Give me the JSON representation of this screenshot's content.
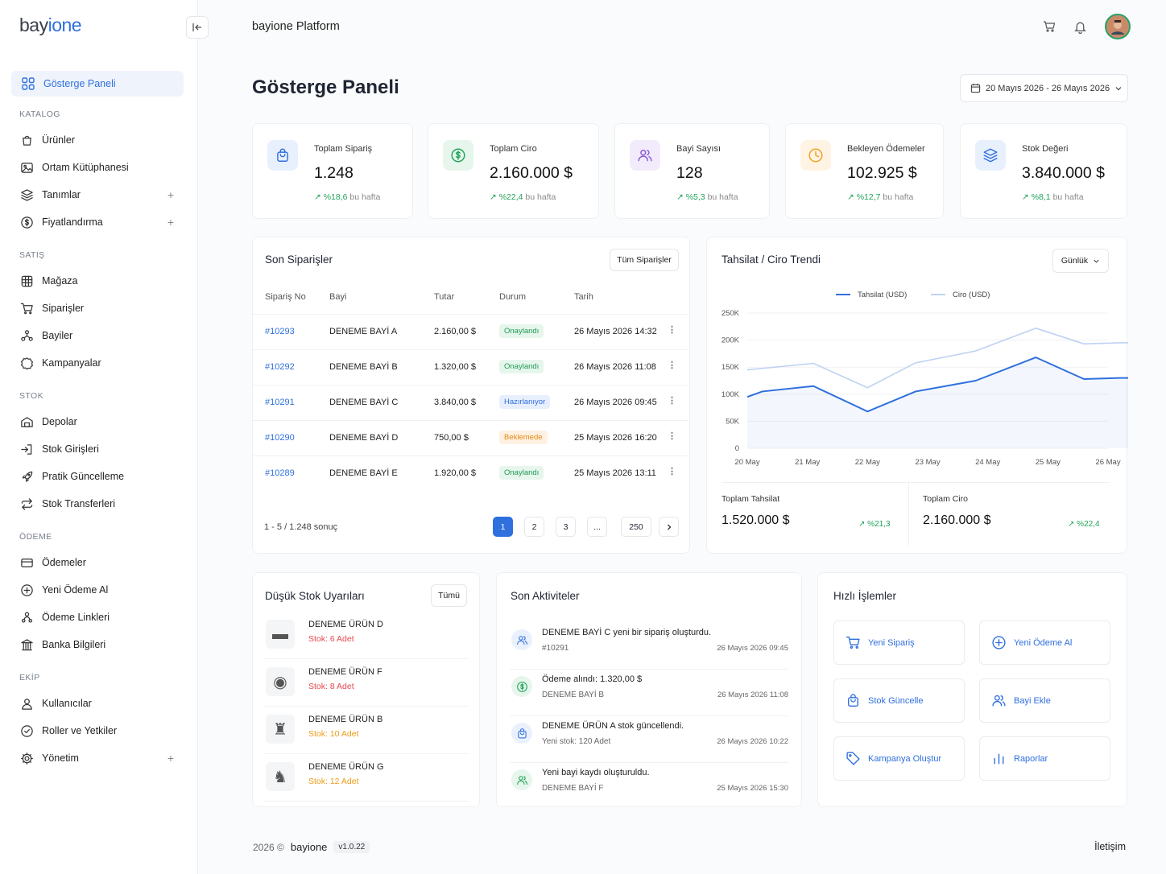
{
  "brand": {
    "logo_part1": "bay",
    "logo_part2": "i",
    "logo_part3": "one"
  },
  "topbar": {
    "title": "bayione Platform"
  },
  "sidebar": {
    "active": {
      "label": "Gösterge Paneli",
      "icon": "dashboard-grid-icon"
    },
    "sections": [
      {
        "title": "KATALOG",
        "items": [
          {
            "label": "Ürünler",
            "icon": "bag-icon",
            "plus": ""
          },
          {
            "label": "Ortam Kütüphanesi",
            "icon": "image-icon",
            "plus": ""
          },
          {
            "label": "Tanımlar",
            "icon": "layers-icon",
            "plus": "+"
          },
          {
            "label": "Fiyatlandırma",
            "icon": "dollar-circle-icon",
            "plus": "+"
          }
        ]
      },
      {
        "title": "SATIŞ",
        "items": [
          {
            "label": "Mağaza",
            "icon": "store-icon",
            "plus": ""
          },
          {
            "label": "Siparişler",
            "icon": "cart-icon",
            "plus": ""
          },
          {
            "label": "Bayiler",
            "icon": "network-icon",
            "plus": ""
          },
          {
            "label": "Kampanyalar",
            "icon": "badge-icon",
            "plus": ""
          }
        ]
      },
      {
        "title": "STOK",
        "items": [
          {
            "label": "Depolar",
            "icon": "warehouse-icon",
            "plus": ""
          },
          {
            "label": "Stok Girişleri",
            "icon": "login-icon",
            "plus": ""
          },
          {
            "label": "Pratik Güncelleme",
            "icon": "rocket-icon",
            "plus": ""
          },
          {
            "label": "Stok Transferleri",
            "icon": "transfer-icon",
            "plus": ""
          }
        ]
      },
      {
        "title": "ÖDEME",
        "items": [
          {
            "label": "Ödemeler",
            "icon": "credit-card-icon",
            "plus": ""
          },
          {
            "label": "Yeni Ödeme Al",
            "icon": "plus-circle-icon",
            "plus": ""
          },
          {
            "label": "Ödeme Linkleri",
            "icon": "link-people-icon",
            "plus": ""
          },
          {
            "label": "Banka Bilgileri",
            "icon": "bank-icon",
            "plus": ""
          }
        ]
      },
      {
        "title": "EKİP",
        "items": [
          {
            "label": "Kullanıcılar",
            "icon": "user-icon",
            "plus": ""
          },
          {
            "label": "Roller ve Yetkiler",
            "icon": "shield-check-icon",
            "plus": ""
          },
          {
            "label": "Yönetim",
            "icon": "gear-icon",
            "plus": "+"
          }
        ]
      }
    ]
  },
  "page": {
    "title": "Gösterge Paneli",
    "date_range": "20 Mayıs 2026 - 26 Mayıs 2026"
  },
  "stats": [
    {
      "label": "Toplam Sipariş",
      "value": "1.248",
      "delta": "%18,6",
      "suffix": "bu hafta",
      "icon": "shopping-bag-icon",
      "color": "#2f6fde",
      "bg": "#e8f0fd"
    },
    {
      "label": "Toplam Ciro",
      "value": "2.160.000 $",
      "delta": "%22,4",
      "suffix": "bu hafta",
      "icon": "dollar-circle-icon",
      "color": "#21a35a",
      "bg": "#e6f6ec"
    },
    {
      "label": "Bayi Sayısı",
      "value": "128",
      "delta": "%5,3",
      "suffix": "bu hafta",
      "icon": "users-icon",
      "color": "#8a5cd6",
      "bg": "#f1ebfb"
    },
    {
      "label": "Bekleyen Ödemeler",
      "value": "102.925 $",
      "delta": "%12,7",
      "suffix": "bu hafta",
      "icon": "clock-icon",
      "color": "#f0a020",
      "bg": "#fff4e3"
    },
    {
      "label": "Stok Değeri",
      "value": "3.840.000 $",
      "delta": "%8,1",
      "suffix": "bu hafta",
      "icon": "layers-icon",
      "color": "#2f6fde",
      "bg": "#e8f0fd"
    }
  ],
  "orders": {
    "title": "Son Siparişler",
    "all_button": "Tüm Siparişler",
    "columns": [
      "Sipariş No",
      "Bayi",
      "Tutar",
      "Durum",
      "Tarih"
    ],
    "rows": [
      {
        "no": "#10293",
        "dealer": "DENEME BAYİ A",
        "amount": "2.160,00 $",
        "status": "Onaylandı",
        "status_type": "green",
        "date": "26 Mayıs 2026 14:32"
      },
      {
        "no": "#10292",
        "dealer": "DENEME BAYİ B",
        "amount": "1.320,00 $",
        "status": "Onaylandı",
        "status_type": "green",
        "date": "26 Mayıs 2026 11:08"
      },
      {
        "no": "#10291",
        "dealer": "DENEME BAYİ C",
        "amount": "3.840,00 $",
        "status": "Hazırlanıyor",
        "status_type": "blue",
        "date": "26 Mayıs 2026 09:45"
      },
      {
        "no": "#10290",
        "dealer": "DENEME BAYİ D",
        "amount": "750,00 $",
        "status": "Beklemede",
        "status_type": "orange",
        "date": "25 Mayıs 2026 16:20"
      },
      {
        "no": "#10289",
        "dealer": "DENEME BAYİ E",
        "amount": "1.920,00 $",
        "status": "Onaylandı",
        "status_type": "green",
        "date": "25 Mayıs 2026 13:11"
      }
    ],
    "summary": "1 - 5 / 1.248 sonuç",
    "pages": [
      "1",
      "2",
      "3",
      "...",
      "250"
    ]
  },
  "trend": {
    "title": "Tahsilat / Ciro Trendi",
    "period": "Günlük",
    "total_collection_label": "Toplam Tahsilat",
    "total_collection_value": "1.520.000 $",
    "total_collection_delta": "%21,3",
    "total_revenue_label": "Toplam Ciro",
    "total_revenue_value": "2.160.000 $",
    "total_revenue_delta": "%22,4"
  },
  "chart_data": {
    "type": "line",
    "x": [
      "20 May",
      "21 May",
      "22 May",
      "23 May",
      "24 May",
      "25 May",
      "26 May"
    ],
    "y_ticks": [
      "0",
      "50K",
      "100K",
      "150K",
      "200K",
      "250K"
    ],
    "ylim": [
      0,
      250000
    ],
    "legend_position": "top-center",
    "grid": true,
    "series": [
      {
        "name": "Tahsilat (USD)",
        "color": "#2f6fde",
        "x": [
          0,
          0.25,
          1.1,
          2.0,
          2.8,
          3.8,
          4.8,
          5.6,
          6.2,
          7.0
        ],
        "values": [
          95000,
          105000,
          115000,
          68000,
          105000,
          125000,
          168000,
          128000,
          130000,
          130000
        ]
      },
      {
        "name": "Ciro (USD)",
        "color": "#bfd2f3",
        "x": [
          0,
          1.1,
          2.0,
          2.8,
          3.8,
          4.8,
          5.6,
          6.2,
          7.0
        ],
        "values": [
          145000,
          157000,
          112000,
          158000,
          180000,
          222000,
          193000,
          195000,
          195000
        ]
      }
    ]
  },
  "low_stock": {
    "title": "Düşük Stok Uyarıları",
    "all_button": "Tümü",
    "items": [
      {
        "name": "DENEME ÜRÜN D",
        "qty": "Stok: 6 Adet",
        "level": "red"
      },
      {
        "name": "DENEME ÜRÜN F",
        "qty": "Stok: 8 Adet",
        "level": "red"
      },
      {
        "name": "DENEME ÜRÜN B",
        "qty": "Stok: 10 Adet",
        "level": "orange"
      },
      {
        "name": "DENEME ÜRÜN G",
        "qty": "Stok: 12 Adet",
        "level": "orange"
      }
    ]
  },
  "activities": {
    "title": "Son Aktiviteler",
    "items": [
      {
        "title": "DENEME BAYİ C yeni bir sipariş oluşturdu.",
        "sub": "#10291",
        "time": "26 Mayıs 2026 09:45",
        "icon": "users-icon",
        "color": "#2f6fde",
        "bg": "#eaf1fd"
      },
      {
        "title": "Ödeme alındı: 1.320,00 $",
        "sub": "DENEME BAYİ B",
        "time": "26 Mayıs 2026 11:08",
        "icon": "dollar-circle-icon",
        "color": "#21a35a",
        "bg": "#e6f6ec"
      },
      {
        "title": "DENEME ÜRÜN A stok güncellendi.",
        "sub": "Yeni stok: 120 Adet",
        "time": "26 Mayıs 2026 10:22",
        "icon": "shopping-bag-icon",
        "color": "#2f6fde",
        "bg": "#eaf1fd"
      },
      {
        "title": "Yeni bayi kaydı oluşturuldu.",
        "sub": "DENEME BAYİ F",
        "time": "25 Mayıs 2026 15:30",
        "icon": "users-icon",
        "color": "#21a35a",
        "bg": "#e6f6ec"
      }
    ]
  },
  "quick_actions": {
    "title": "Hızlı İşlemler",
    "items": [
      {
        "label": "Yeni Sipariş",
        "icon": "cart-icon"
      },
      {
        "label": "Yeni Ödeme Al",
        "icon": "plus-circle-icon"
      },
      {
        "label": "Stok Güncelle",
        "icon": "shopping-bag-icon"
      },
      {
        "label": "Bayi Ekle",
        "icon": "user-plus-icon"
      },
      {
        "label": "Kampanya Oluştur",
        "icon": "tag-icon"
      },
      {
        "label": "Raporlar",
        "icon": "bar-chart-icon"
      }
    ]
  },
  "footer": {
    "year": "2026 ©",
    "brand": "bayione",
    "version": "v1.0.22",
    "contact": "İletişim"
  }
}
